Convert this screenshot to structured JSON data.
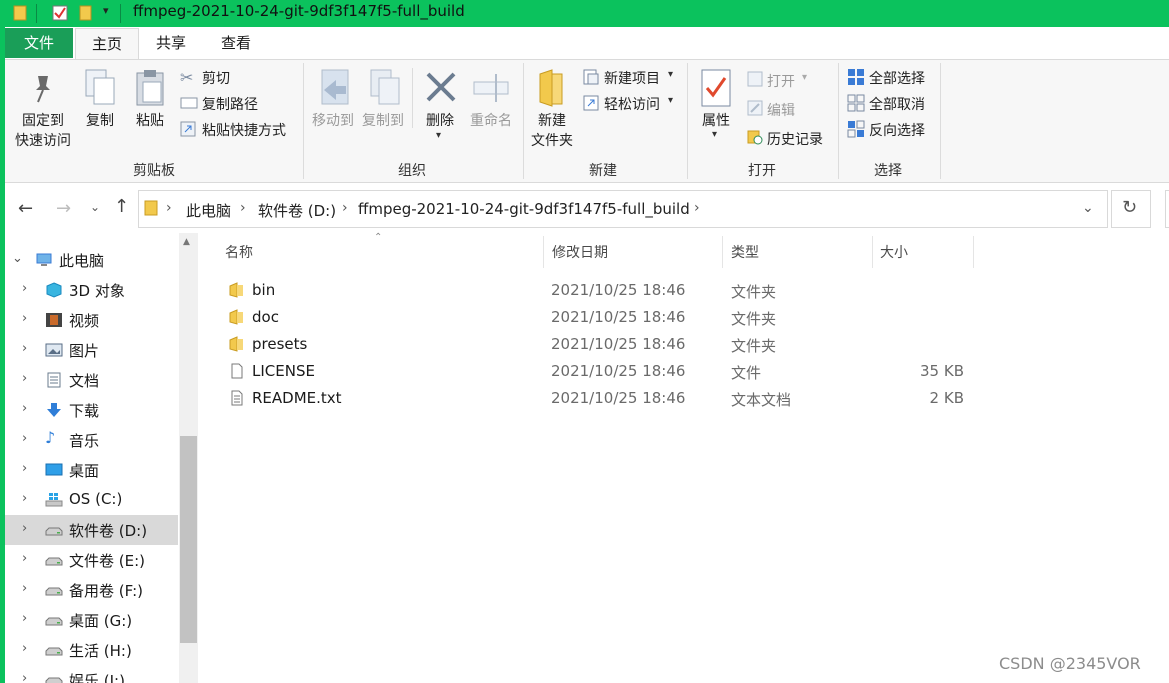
{
  "window": {
    "title": "ffmpeg-2021-10-24-git-9df3f147f5-full_build",
    "title_bar_color": "#0bc25d"
  },
  "tabs": [
    {
      "label": "文件"
    },
    {
      "label": "主页"
    },
    {
      "label": "共享"
    },
    {
      "label": "查看"
    }
  ],
  "ribbon": {
    "clipboard": {
      "pin_line1": "固定到",
      "pin_line2": "快速访问",
      "copy": "复制",
      "paste": "粘贴",
      "cut": "剪切",
      "copy_path": "复制路径",
      "paste_shortcut": "粘贴快捷方式",
      "group_label": "剪贴板"
    },
    "organize": {
      "move_to": "移动到",
      "copy_to": "复制到",
      "delete": "删除",
      "rename": "重命名",
      "group_label": "组织"
    },
    "new": {
      "new_folder_line1": "新建",
      "new_folder_line2": "文件夹",
      "new_item": "新建项目",
      "easy_access": "轻松访问",
      "group_label": "新建"
    },
    "open": {
      "properties": "属性",
      "open": "打开",
      "edit": "编辑",
      "history": "历史记录",
      "group_label": "打开"
    },
    "select": {
      "select_all": "全部选择",
      "select_none": "全部取消",
      "invert": "反向选择",
      "group_label": "选择"
    }
  },
  "address": {
    "crumbs": [
      "此电脑",
      "软件卷 (D:)",
      "ffmpeg-2021-10-24-git-9df3f147f5-full_build"
    ]
  },
  "nav": {
    "items": [
      {
        "label": "此电脑",
        "icon": "computer-icon"
      },
      {
        "label": "3D 对象",
        "icon": "cube-icon"
      },
      {
        "label": "视频",
        "icon": "video-icon"
      },
      {
        "label": "图片",
        "icon": "picture-icon"
      },
      {
        "label": "文档",
        "icon": "document-icon"
      },
      {
        "label": "下载",
        "icon": "download-icon"
      },
      {
        "label": "音乐",
        "icon": "music-icon"
      },
      {
        "label": "桌面",
        "icon": "desktop-icon"
      },
      {
        "label": "OS (C:)",
        "icon": "windows-drive-icon"
      },
      {
        "label": "软件卷 (D:)",
        "icon": "drive-icon"
      },
      {
        "label": "文件卷 (E:)",
        "icon": "drive-icon"
      },
      {
        "label": "备用卷 (F:)",
        "icon": "drive-icon"
      },
      {
        "label": "桌面 (G:)",
        "icon": "drive-icon"
      },
      {
        "label": "生活 (H:)",
        "icon": "drive-icon"
      },
      {
        "label": "娱乐 (I:)",
        "icon": "drive-icon"
      }
    ]
  },
  "columns": {
    "name": "名称",
    "modified": "修改日期",
    "type": "类型",
    "size": "大小"
  },
  "files": [
    {
      "name": "bin",
      "modified": "2021/10/25 18:46",
      "type": "文件夹",
      "size": "",
      "icon": "folder-icon"
    },
    {
      "name": "doc",
      "modified": "2021/10/25 18:46",
      "type": "文件夹",
      "size": "",
      "icon": "folder-icon"
    },
    {
      "name": "presets",
      "modified": "2021/10/25 18:46",
      "type": "文件夹",
      "size": "",
      "icon": "folder-icon"
    },
    {
      "name": "LICENSE",
      "modified": "2021/10/25 18:46",
      "type": "文件",
      "size": "35 KB",
      "icon": "file-icon"
    },
    {
      "name": "README.txt",
      "modified": "2021/10/25 18:46",
      "type": "文本文档",
      "size": "2 KB",
      "icon": "text-file-icon"
    }
  ],
  "watermark": "CSDN @2345VOR"
}
